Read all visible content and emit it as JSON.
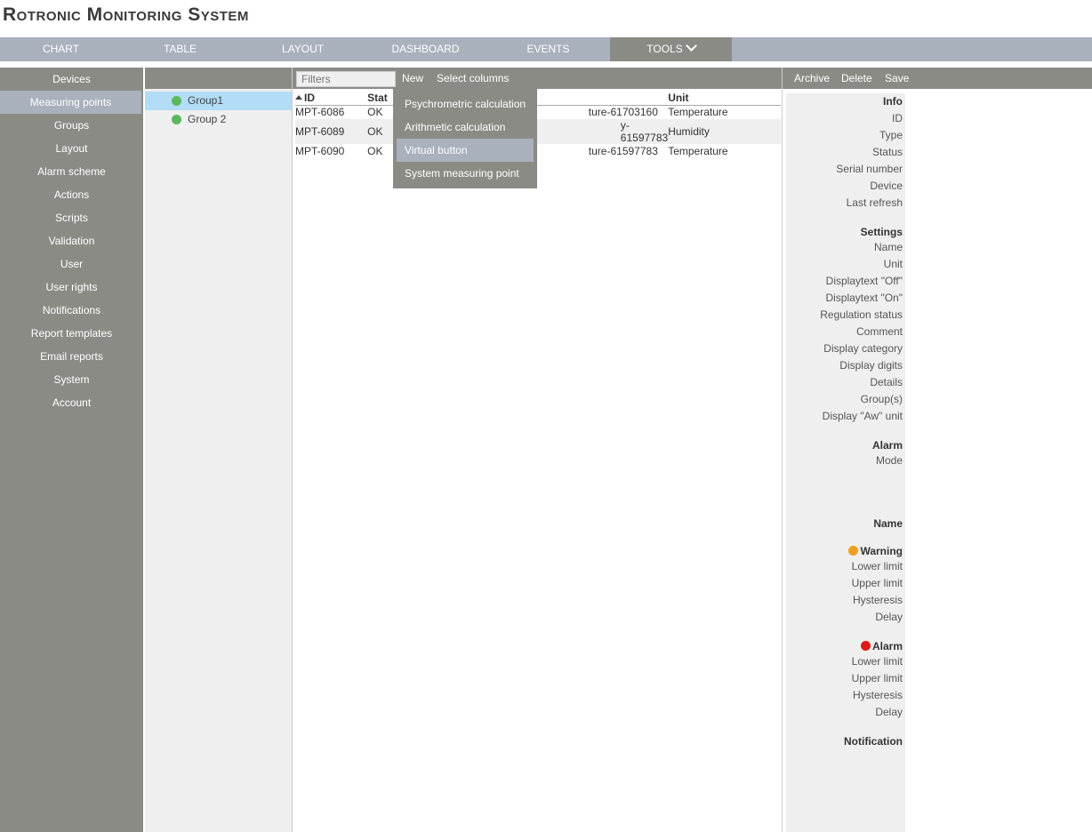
{
  "app": {
    "title": "Rotronic Monitoring System"
  },
  "topnav": {
    "tabs": [
      "CHART",
      "TABLE",
      "LAYOUT",
      "DASHBOARD",
      "EVENTS",
      "TOOLS"
    ]
  },
  "sidebar": {
    "items": [
      "Devices",
      "Measuring points",
      "Groups",
      "Layout",
      "Alarm scheme",
      "Actions",
      "Scripts",
      "Validation",
      "User",
      "User rights",
      "Notifications",
      "Report templates",
      "Email reports",
      "System",
      "Account"
    ]
  },
  "groups": {
    "items": [
      "Group1",
      "Group 2"
    ]
  },
  "main": {
    "filter_placeholder": "Filters",
    "new_label": "New",
    "select_columns_label": "Select columns",
    "columns": {
      "id": "ID",
      "status": "Stat",
      "unit": "Unit"
    },
    "rows": [
      {
        "id": "MPT-6086",
        "status": "OK",
        "name": "ture-61703160",
        "unit": "Temperature"
      },
      {
        "id": "MPT-6089",
        "status": "OK",
        "name": "y-61597783",
        "unit": "Humidity"
      },
      {
        "id": "MPT-6090",
        "status": "OK",
        "name": "ture-61597783",
        "unit": "Temperature"
      }
    ]
  },
  "dropdown": {
    "options": [
      "Psychrometric calculation",
      "Arithmetic calculation",
      "Virtual button",
      "System measuring point"
    ]
  },
  "right": {
    "toolbar": {
      "archive": "Archive",
      "delete": "Delete",
      "save": "Save"
    },
    "info": {
      "header": "Info",
      "fields": [
        "ID",
        "Type",
        "Status",
        "Serial number",
        "Device",
        "Last refresh"
      ]
    },
    "settings": {
      "header": "Settings",
      "fields": [
        "Name",
        "Unit",
        "Displaytext \"Off\"",
        "Displaytext \"On\"",
        "Regulation status",
        "Comment",
        "Display category",
        "Display digits",
        "Details",
        "Group(s)",
        "Display \"Aw\" unit"
      ]
    },
    "alarm_section": {
      "header": "Alarm",
      "mode": "Mode"
    },
    "name_header": "Name",
    "warning": {
      "header": "Warning",
      "fields": [
        "Lower limit",
        "Upper limit",
        "Hysteresis",
        "Delay"
      ]
    },
    "alarm": {
      "header": "Alarm",
      "fields": [
        "Lower limit",
        "Upper limit",
        "Hysteresis",
        "Delay"
      ]
    },
    "notification_header": "Notification"
  },
  "colors": {
    "nav_bar": "#a9b1bd",
    "sidebar": "#8b8b86",
    "selected_group": "#b3dcf6",
    "group_dot": "#5cb85c",
    "warning": "#f0a020",
    "alarm": "#e01818"
  }
}
